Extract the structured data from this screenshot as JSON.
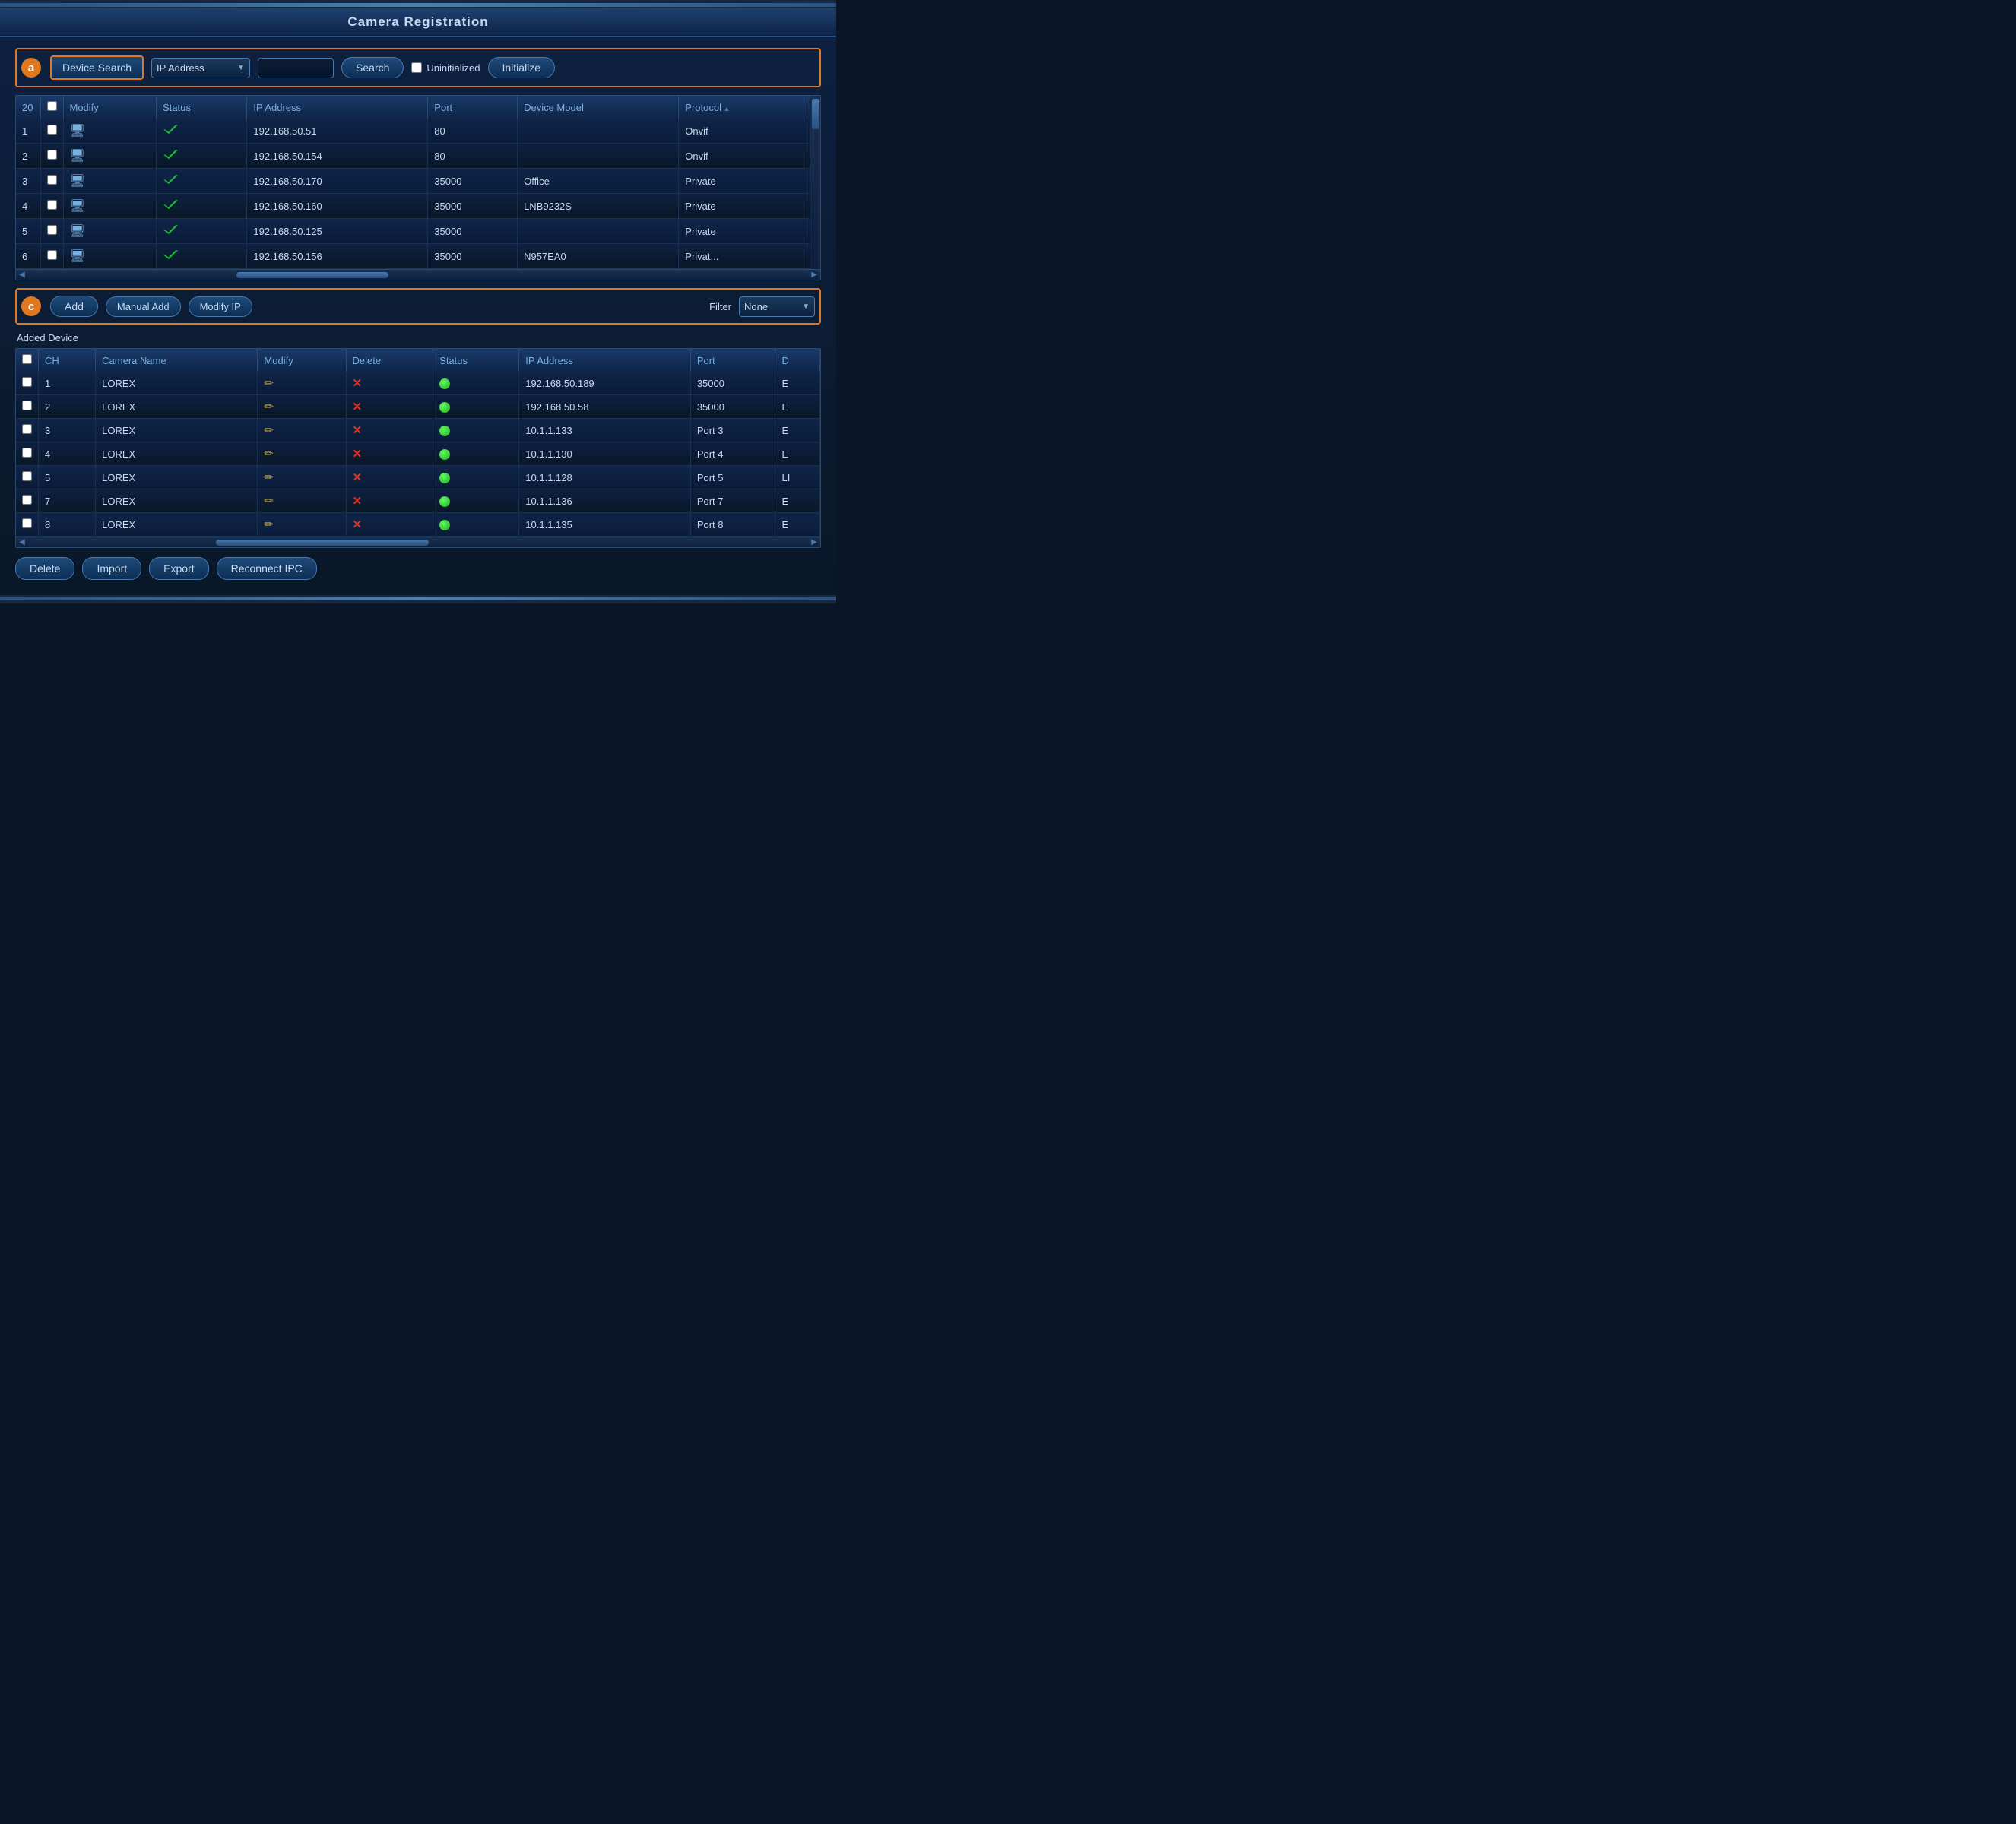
{
  "title": "Camera Registration",
  "toolbar_a": {
    "badge": "a",
    "device_search_label": "Device Search",
    "ip_address_label": "IP Address",
    "search_input_placeholder": "",
    "search_button_label": "Search",
    "uninitialized_label": "Uninitialized",
    "initialize_button_label": "Initialize"
  },
  "device_table": {
    "count": "20",
    "headers": [
      "",
      "Modify",
      "Status",
      "IP Address",
      "Port",
      "Device Model",
      "Protocol"
    ],
    "rows": [
      {
        "num": "1",
        "ip": "192.168.50.51",
        "port": "80",
        "model": "",
        "protocol": "Onvif"
      },
      {
        "num": "2",
        "ip": "192.168.50.154",
        "port": "80",
        "model": "",
        "protocol": "Onvif"
      },
      {
        "num": "3",
        "ip": "192.168.50.170",
        "port": "35000",
        "model": "Office",
        "protocol": "Private"
      },
      {
        "num": "4",
        "ip": "192.168.50.160",
        "port": "35000",
        "model": "LNB9232S",
        "protocol": "Private"
      },
      {
        "num": "5",
        "ip": "192.168.50.125",
        "port": "35000",
        "model": "",
        "protocol": "Private"
      },
      {
        "num": "6",
        "ip": "192.168.50.156",
        "port": "35000",
        "model": "N957EA0",
        "protocol": "Privat..."
      }
    ]
  },
  "toolbar_c": {
    "badge": "c",
    "add_label": "Add",
    "manual_add_label": "Manual Add",
    "modify_ip_label": "Modify IP",
    "filter_label": "Filter",
    "filter_value": "None"
  },
  "added_device_section_label": "Added Device",
  "added_table": {
    "headers": [
      "",
      "CH",
      "Camera Name",
      "Modify",
      "Delete",
      "Status",
      "IP Address",
      "Port",
      "D"
    ],
    "rows": [
      {
        "ch": "1",
        "name": "LOREX",
        "ip": "192.168.50.189",
        "port": "35000",
        "d": "E"
      },
      {
        "ch": "2",
        "name": "LOREX",
        "ip": "192.168.50.58",
        "port": "35000",
        "d": "E"
      },
      {
        "ch": "3",
        "name": "LOREX",
        "ip": "10.1.1.133",
        "port": "Port 3",
        "d": "E"
      },
      {
        "ch": "4",
        "name": "LOREX",
        "ip": "10.1.1.130",
        "port": "Port 4",
        "d": "E"
      },
      {
        "ch": "5",
        "name": "LOREX",
        "ip": "10.1.1.128",
        "port": "Port 5",
        "d": "LI"
      },
      {
        "ch": "7",
        "name": "LOREX",
        "ip": "10.1.1.136",
        "port": "Port 7",
        "d": "E"
      },
      {
        "ch": "8",
        "name": "LOREX",
        "ip": "10.1.1.135",
        "port": "Port 8",
        "d": "E"
      }
    ]
  },
  "bottom_buttons": {
    "delete_label": "Delete",
    "import_label": "Import",
    "export_label": "Export",
    "reconnect_label": "Reconnect IPC"
  }
}
